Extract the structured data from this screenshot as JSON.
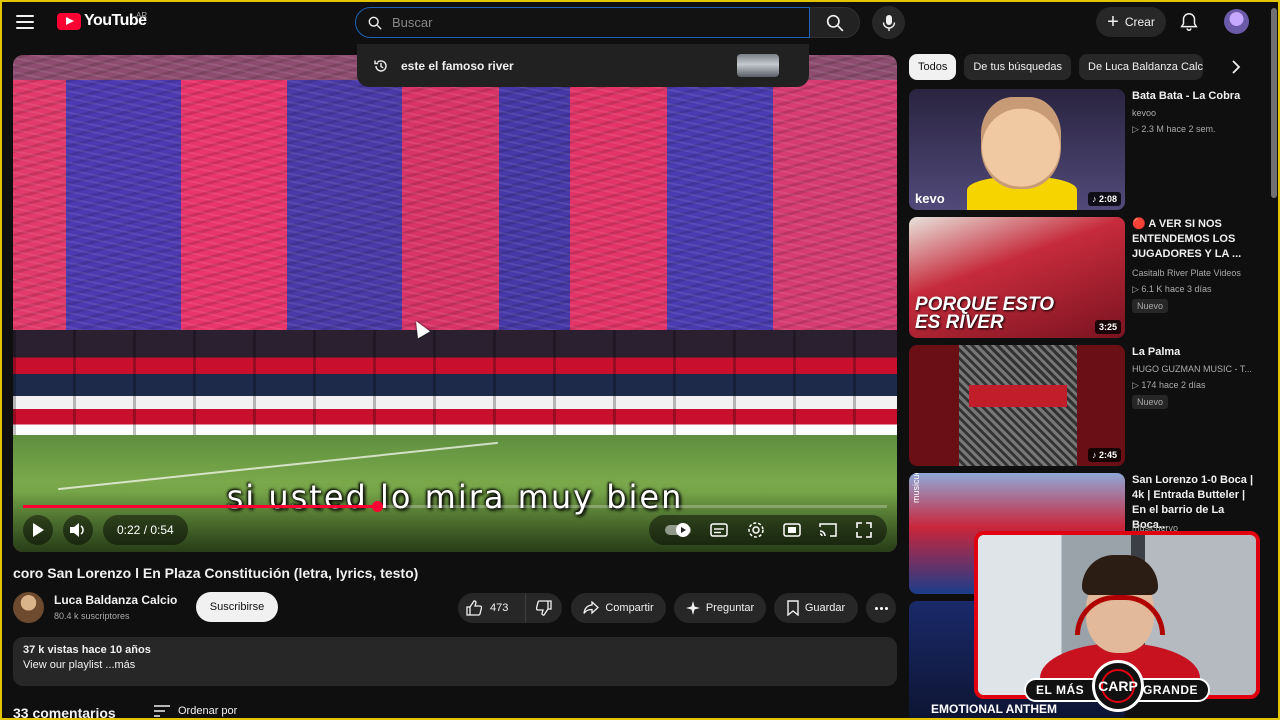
{
  "header": {
    "logo_text": "YouTube",
    "country_code": "AR",
    "search_placeholder": "Buscar",
    "create_label": "Crear"
  },
  "search_suggestion": {
    "text": "este el famoso river"
  },
  "player": {
    "subtitle": "si usted lo mira muy bien",
    "time": "0:22 / 0:54",
    "progress_fraction": 0.41
  },
  "video": {
    "title": "coro San Lorenzo l En Plaza Constitución (letra, lyrics, testo)",
    "channel": "Luca Baldanza Calcio",
    "subscribers": "80.4 k suscriptores",
    "subscribe_label": "Suscribirse",
    "likes": "473",
    "share_label": "Compartir",
    "ask_label": "Preguntar",
    "save_label": "Guardar",
    "views_date": "37 k vistas  hace 10 años",
    "description": "View our playlist ...más",
    "comments": "33 comentarios",
    "sort_label": "Ordenar por"
  },
  "chips": [
    "Todos",
    "De tus búsquedas",
    "De Luca Baldanza Calcio"
  ],
  "recommendations": [
    {
      "title": "Bata Bata - La Cobra",
      "channel": "kevoo",
      "meta": "▷ 2.3 M  hace 2 sem.",
      "duration": "♪ 2:08",
      "badge": "",
      "thumb_text": "kevo"
    },
    {
      "title": "🔴 A VER SI NOS ENTENDEMOS LOS JUGADORES Y LA ...",
      "channel": "Casitalb River Plate Videos",
      "meta": "▷ 6.1 K  hace 3 días",
      "duration": "3:25",
      "badge": "Nuevo",
      "thumb_text": "PORQUE ESTO ES RIVER"
    },
    {
      "title": "La Palma",
      "channel": "HUGO GUZMAN MUSIC - T...",
      "meta": "▷ 174  hace 2 días",
      "duration": "♪ 2:45",
      "badge": "Nuevo",
      "thumb_text": ""
    },
    {
      "title": "San Lorenzo 1-0 Boca | 4k | Entrada Butteler | En el barrio de La Boca...",
      "channel": "musicuervo",
      "meta": "",
      "duration": "",
      "badge": "",
      "thumb_text": "musicuervo"
    },
    {
      "title": "",
      "channel": "",
      "meta": "",
      "duration": "",
      "badge": "",
      "thumb_text": "EMOTIONAL ANTHEM"
    }
  ],
  "overlay": {
    "left_text": "EL MÁS",
    "right_text": "GRANDE",
    "logo_text": "CARP"
  },
  "colors": {
    "accent": "#ff0033",
    "background": "#0f0f0f",
    "frame": "#e3c400",
    "webcam_border": "#e00010"
  }
}
